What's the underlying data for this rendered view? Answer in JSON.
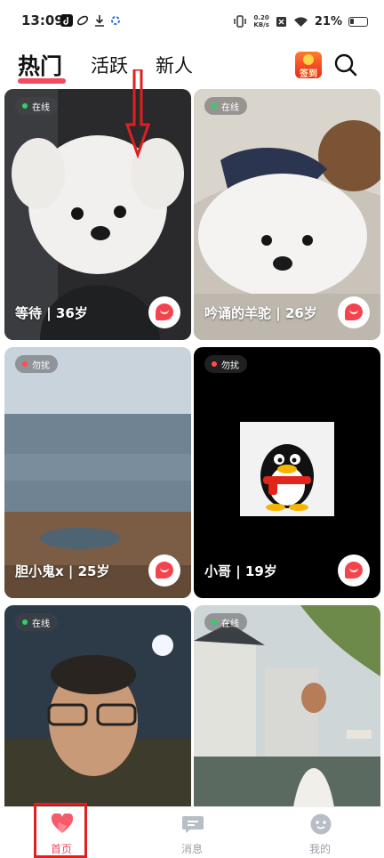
{
  "status_bar": {
    "time": "13:09",
    "net_speed_value": "0.20",
    "net_speed_unit": "KB/s",
    "battery": "21%",
    "icons": [
      "tiktok-icon",
      "download-icon",
      "vibrate-icon",
      "wifi-icon",
      "battery-icon"
    ]
  },
  "header": {
    "tabs": [
      {
        "label": "热门",
        "active": true
      },
      {
        "label": "活跃",
        "active": false
      },
      {
        "label": "新人",
        "active": false
      }
    ],
    "checkin_label": "签到"
  },
  "cards": [
    {
      "status": "在线",
      "status_color": "#2fd06a",
      "caption": "等待 | 36岁"
    },
    {
      "status": "在线",
      "status_color": "#2fd06a",
      "caption": "吟诵的羊驼 | 26岁"
    },
    {
      "status": "勿扰",
      "status_color": "#ff4d4f",
      "caption": "胆小鬼x | 25岁"
    },
    {
      "status": "勿扰",
      "status_color": "#ff4d4f",
      "caption": "小哥 | 19岁"
    },
    {
      "status": "在线",
      "status_color": "#2fd06a",
      "caption": ""
    },
    {
      "status": "在线",
      "status_color": "#2fd06a",
      "caption": ""
    }
  ],
  "bottom_nav": [
    {
      "label": "首页",
      "icon": "heart-icon",
      "active": true
    },
    {
      "label": "消息",
      "icon": "message-icon",
      "active": false
    },
    {
      "label": "我的",
      "icon": "profile-icon",
      "active": false
    }
  ],
  "colors": {
    "accent": "#f24b5d",
    "online": "#2fd06a",
    "dnd": "#ff4d4f"
  }
}
